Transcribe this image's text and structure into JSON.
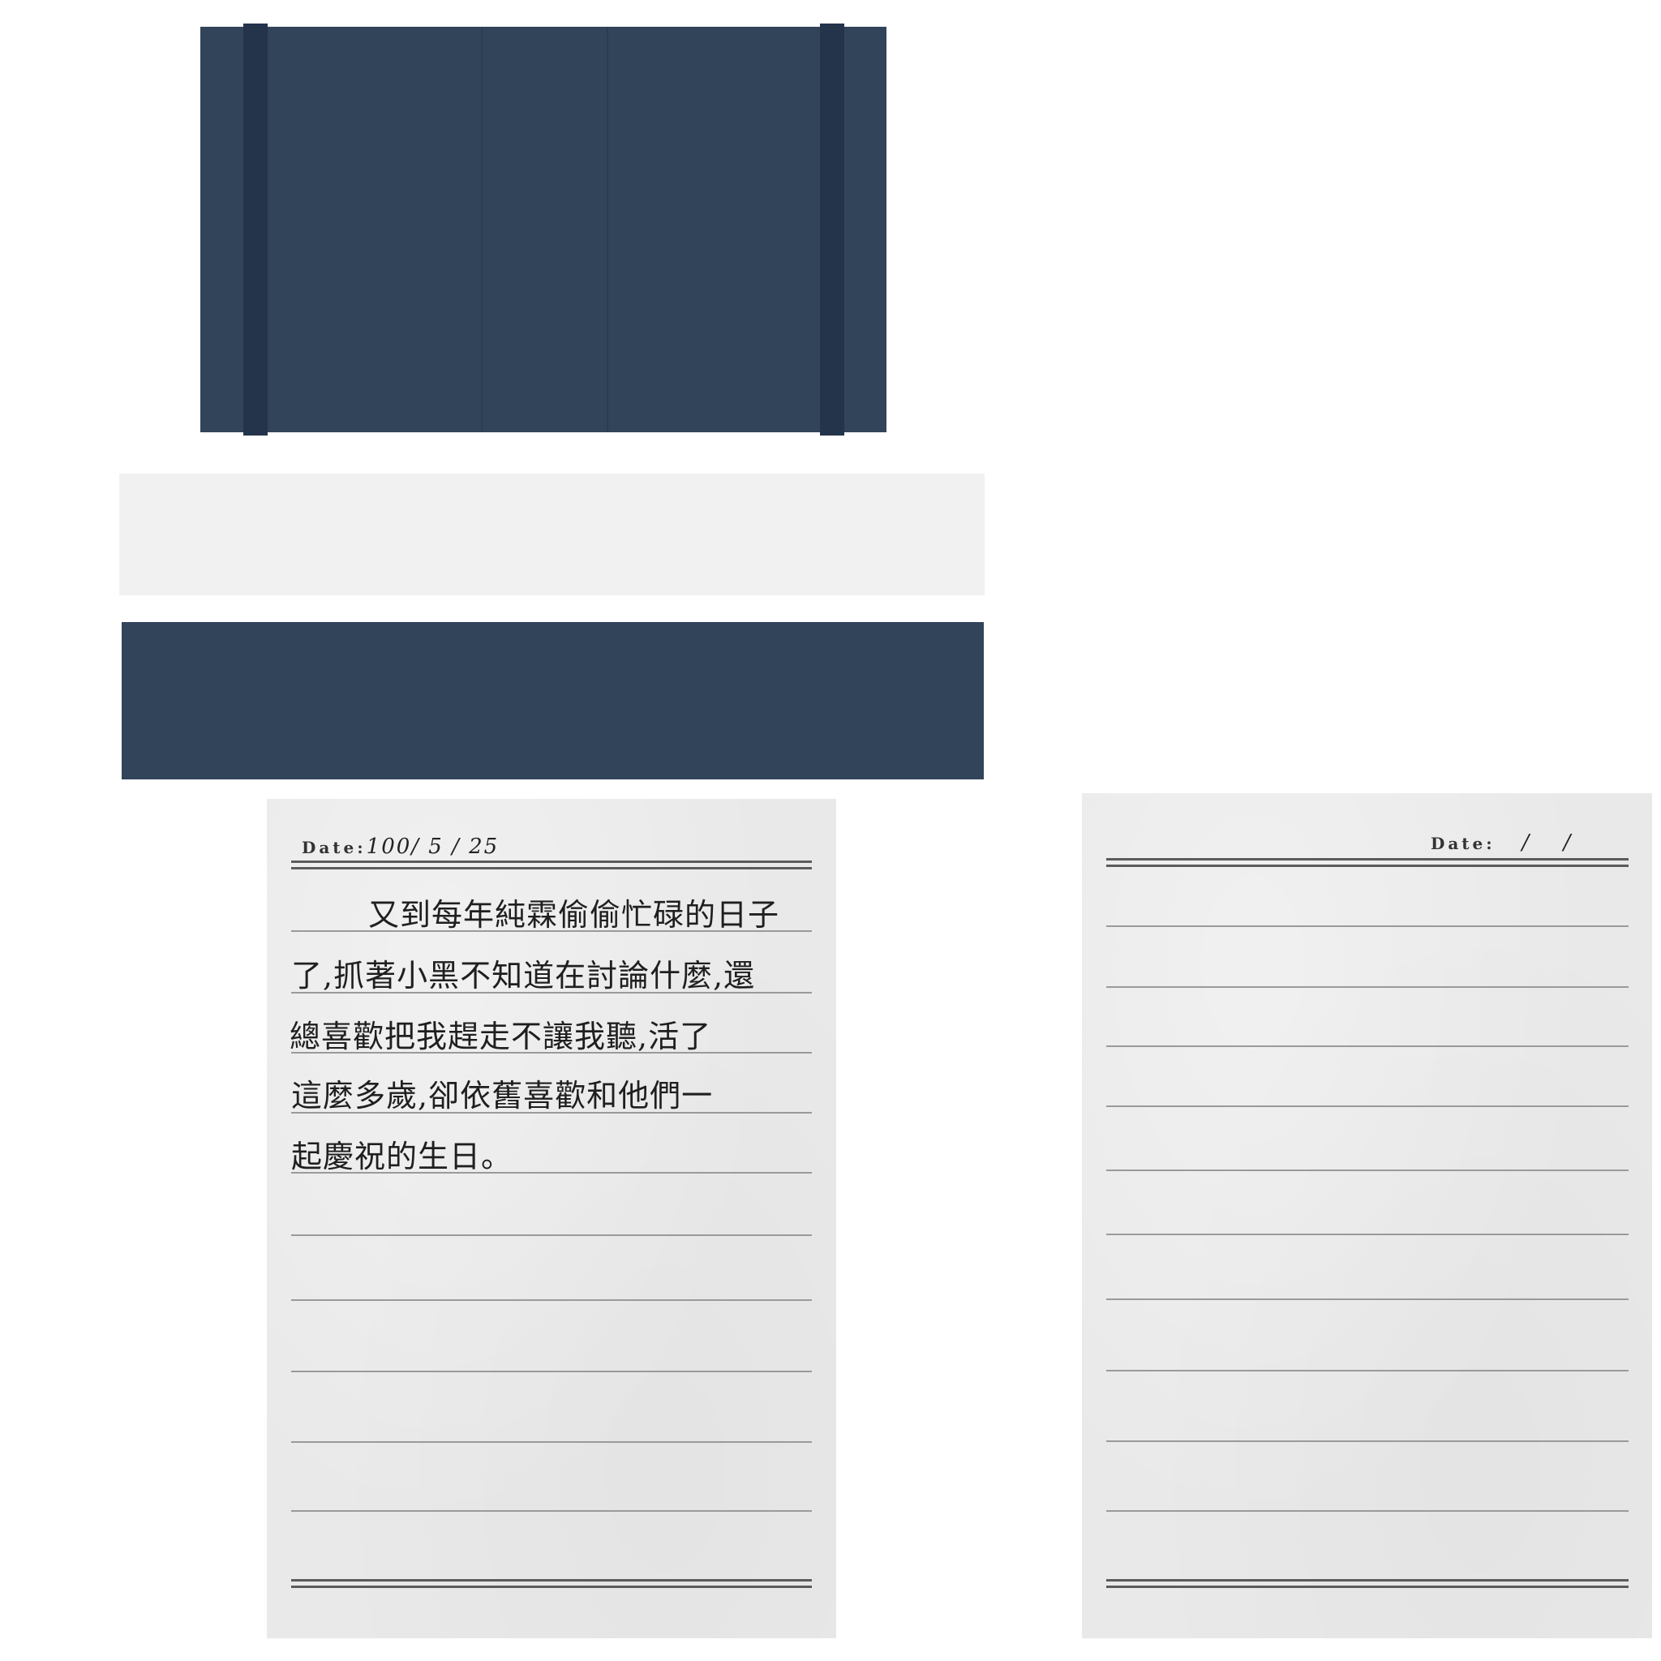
{
  "colors": {
    "cover": "#32445a",
    "cover_strap": "#24354b",
    "paper": "#e9e9e9",
    "page_edge": "#f1f1f1"
  },
  "left_page": {
    "date_label": "Date:",
    "date_value": "100/ 5 / 25",
    "lines": [
      "又到每年純霖偷偷忙碌的日子",
      "了,抓著小黑不知道在討論什麼,還",
      "總喜歡把我趕走不讓我聽,活了",
      "這麼多歲,卻依舊喜歡和他們一",
      "起慶祝的生日。"
    ]
  },
  "right_page": {
    "date_label": "Date:",
    "date_value": "/ /"
  }
}
